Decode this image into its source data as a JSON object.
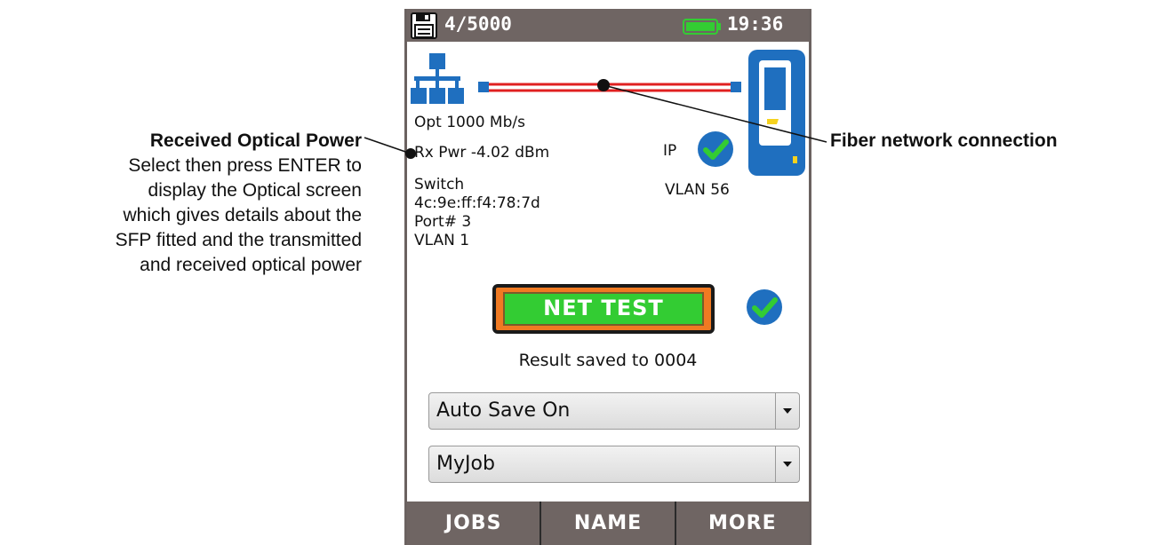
{
  "status_bar": {
    "counter": "4/5000",
    "time": "19:36"
  },
  "link": {
    "speed": "Opt 1000 Mb/s",
    "rx_power": "Rx Pwr -4.02 dBm"
  },
  "switch": {
    "label": "Switch",
    "mac": "4c:9e:ff:f4:78:7d",
    "port": "Port# 3",
    "vlan": "VLAN 1"
  },
  "ip": {
    "label": "IP",
    "vlan": "VLAN 56"
  },
  "net_test": {
    "label": "NET TEST",
    "result_text": "Result saved to  0004"
  },
  "auto_save": {
    "value": "Auto Save On"
  },
  "job": {
    "value": "MyJob"
  },
  "softkeys": [
    "JOBS",
    "NAME",
    "MORE"
  ],
  "callouts": {
    "rx_title": "Received Optical Power",
    "rx_desc_lines": [
      "Select then press ENTER to",
      "display the Optical screen",
      "which gives details about the",
      "SFP fitted and the transmitted",
      "and received optical power"
    ],
    "fiber": "Fiber network connection"
  },
  "colors": {
    "bar": "#6f6563",
    "accent_blue": "#1f6fbf",
    "check_green": "#33cc33",
    "fiber_red": "#e02020",
    "button_orange": "#f07a22"
  },
  "icons": [
    "save-icon",
    "battery-icon",
    "network-icon",
    "tester-icon",
    "check-icon",
    "dropdown-arrow-icon"
  ]
}
